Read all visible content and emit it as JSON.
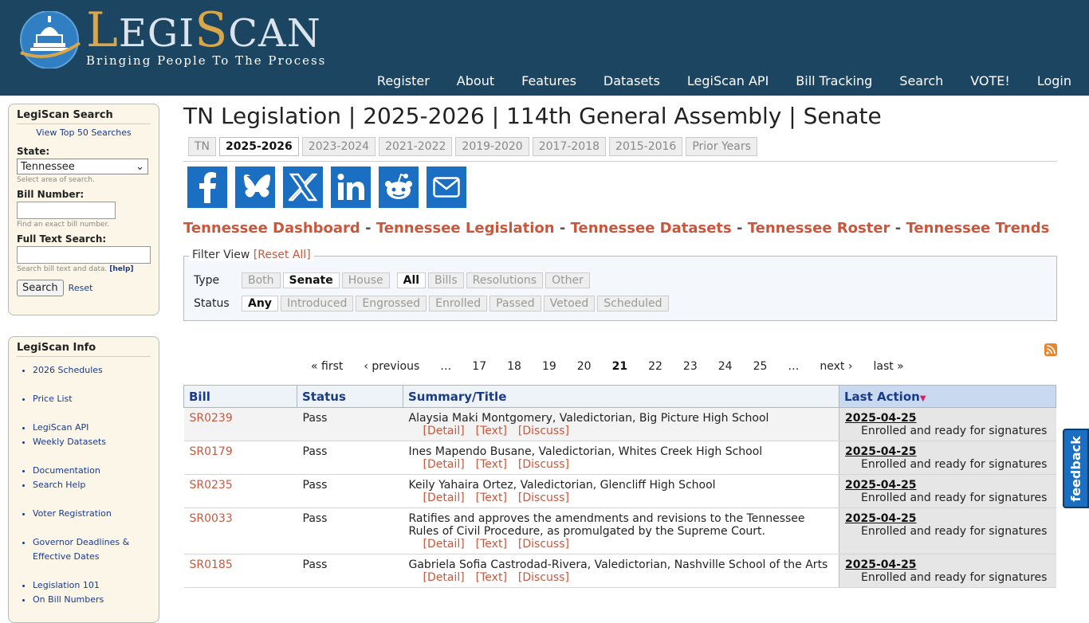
{
  "header": {
    "logo_word": "LegiScan",
    "logo_tagline": "Bringing People To The Process",
    "nav": [
      "Register",
      "About",
      "Features",
      "Datasets",
      "LegiScan API",
      "Bill Tracking",
      "Search",
      "VOTE!",
      "Login"
    ]
  },
  "sidebar": {
    "search": {
      "title": "LegiScan Search",
      "top50": "View Top 50 Searches",
      "state_label": "State:",
      "state_value": "Tennessee",
      "state_help": "Select area of search.",
      "bill_label": "Bill Number:",
      "bill_help": "Find an exact bill number.",
      "fulltext_label": "Full Text Search:",
      "fulltext_help": "Search bill text and data.",
      "help_link": "[help]",
      "search_button": "Search",
      "reset_link": "Reset"
    },
    "info": {
      "title": "LegiScan Info",
      "items": [
        "2026 Schedules",
        "Price List",
        "LegiScan API",
        "Weekly Datasets",
        "Documentation",
        "Search Help",
        "Voter Registration",
        "Governor Deadlines & Effective Dates",
        "Legislation 101",
        "On Bill Numbers"
      ]
    }
  },
  "main": {
    "title": "TN Legislation | 2025-2026 | 114th General Assembly | Senate",
    "year_tabs": [
      "TN",
      "2025-2026",
      "2023-2024",
      "2021-2022",
      "2019-2020",
      "2017-2018",
      "2015-2016",
      "Prior Years"
    ],
    "active_year_tab": "2025-2026",
    "social": [
      "facebook-icon",
      "bluesky-icon",
      "x-icon",
      "linkedin-icon",
      "reddit-icon",
      "email-icon"
    ],
    "state_links": [
      "Tennessee Dashboard",
      "Tennessee Legislation",
      "Tennessee Datasets",
      "Tennessee Roster",
      "Tennessee Trends"
    ],
    "state_links_sep": " - ",
    "filter": {
      "legend": "Filter View",
      "reset": "[Reset All]",
      "type_label": "Type",
      "type_chamber": [
        "Both",
        "Senate",
        "House"
      ],
      "type_kind": [
        "All",
        "Bills",
        "Resolutions",
        "Other"
      ],
      "status_label": "Status",
      "status": [
        "Any",
        "Introduced",
        "Engrossed",
        "Enrolled",
        "Passed",
        "Vetoed",
        "Scheduled"
      ],
      "active_chamber": "Senate",
      "active_kind": "All",
      "active_status": "Any"
    },
    "pager": [
      "« first",
      "‹ previous",
      "…",
      "17",
      "18",
      "19",
      "20",
      "21",
      "22",
      "23",
      "24",
      "25",
      "…",
      "next ›",
      "last »"
    ],
    "current_page": "21",
    "table": {
      "headers": [
        "Bill",
        "Status",
        "Summary/Title",
        "Last Action"
      ],
      "sub_links": [
        "[Detail]",
        "[Text]",
        "[Discuss]"
      ],
      "rows": [
        {
          "bill": "SR0239",
          "status": "Pass",
          "title": "Alaysia Maki Montgomery, Valedictorian, Big Picture High School",
          "date": "2025-04-25",
          "action": "Enrolled and ready for signatures"
        },
        {
          "bill": "SR0179",
          "status": "Pass",
          "title": "Ines Mapendo Busane, Valedictorian, Whites Creek High School",
          "date": "2025-04-25",
          "action": "Enrolled and ready for signatures"
        },
        {
          "bill": "SR0235",
          "status": "Pass",
          "title": "Keily Yahaira Ortez, Valedictorian, Glencliff High School",
          "date": "2025-04-25",
          "action": "Enrolled and ready for signatures"
        },
        {
          "bill": "SR0033",
          "status": "Pass",
          "title": "Ratifies and approves the amendments and revisions to the Tennessee Rules of Civil Procedure, as promulgated by the Supreme Court.",
          "date": "2025-04-25",
          "action": "Enrolled and ready for signatures"
        },
        {
          "bill": "SR0185",
          "status": "Pass",
          "title": "Gabriela Sofia Castrodad-Rivera, Valedictorian, Nashville School of the Arts",
          "date": "2025-04-25",
          "action": "Enrolled and ready for signatures"
        }
      ]
    }
  },
  "feedback": "feedback",
  "colors": {
    "header_bg": "#1b4560",
    "link_accent": "#c8583d",
    "table_link": "#1a3a8a"
  }
}
